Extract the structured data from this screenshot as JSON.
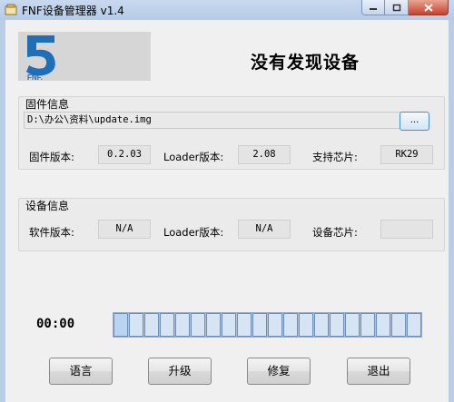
{
  "window": {
    "title": "FNF设备管理器 v1.4"
  },
  "logo": {
    "text": "FNF."
  },
  "status": {
    "title": "没有发现设备"
  },
  "firmware": {
    "group_label": "固件信息",
    "path": "D:\\办公\\资料\\update.img",
    "browse_label": "...",
    "fw_version_label": "固件版本:",
    "fw_version": "0.2.03",
    "loader_label": "Loader版本:",
    "loader_version": "2.08",
    "chip_label": "支持芯片:",
    "chip": "RK29"
  },
  "device": {
    "group_label": "设备信息",
    "sw_version_label": "软件版本:",
    "sw_version": "N/A",
    "loader_label": "Loader版本:",
    "loader_version": "N/A",
    "chip_label": "设备芯片:",
    "chip": ""
  },
  "progress": {
    "time": "00:00",
    "segments": 20,
    "filled": 0
  },
  "buttons": {
    "language": "语言",
    "upgrade": "升级",
    "repair": "修复",
    "exit": "退出"
  },
  "colors": {
    "accent": "#1f6fb8",
    "titlebar": "#c8d9ef"
  }
}
